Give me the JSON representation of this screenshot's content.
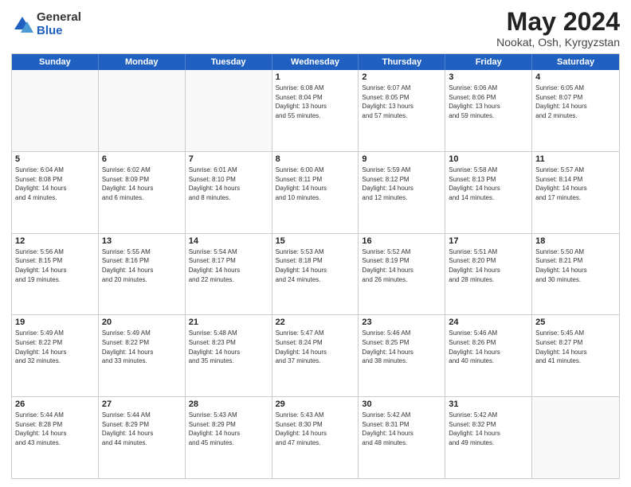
{
  "logo": {
    "general": "General",
    "blue": "Blue"
  },
  "title": {
    "month": "May 2024",
    "location": "Nookat, Osh, Kyrgyzstan"
  },
  "header_days": [
    "Sunday",
    "Monday",
    "Tuesday",
    "Wednesday",
    "Thursday",
    "Friday",
    "Saturday"
  ],
  "rows": [
    [
      {
        "day": "",
        "info": ""
      },
      {
        "day": "",
        "info": ""
      },
      {
        "day": "",
        "info": ""
      },
      {
        "day": "1",
        "info": "Sunrise: 6:08 AM\nSunset: 8:04 PM\nDaylight: 13 hours\nand 55 minutes."
      },
      {
        "day": "2",
        "info": "Sunrise: 6:07 AM\nSunset: 8:05 PM\nDaylight: 13 hours\nand 57 minutes."
      },
      {
        "day": "3",
        "info": "Sunrise: 6:06 AM\nSunset: 8:06 PM\nDaylight: 13 hours\nand 59 minutes."
      },
      {
        "day": "4",
        "info": "Sunrise: 6:05 AM\nSunset: 8:07 PM\nDaylight: 14 hours\nand 2 minutes."
      }
    ],
    [
      {
        "day": "5",
        "info": "Sunrise: 6:04 AM\nSunset: 8:08 PM\nDaylight: 14 hours\nand 4 minutes."
      },
      {
        "day": "6",
        "info": "Sunrise: 6:02 AM\nSunset: 8:09 PM\nDaylight: 14 hours\nand 6 minutes."
      },
      {
        "day": "7",
        "info": "Sunrise: 6:01 AM\nSunset: 8:10 PM\nDaylight: 14 hours\nand 8 minutes."
      },
      {
        "day": "8",
        "info": "Sunrise: 6:00 AM\nSunset: 8:11 PM\nDaylight: 14 hours\nand 10 minutes."
      },
      {
        "day": "9",
        "info": "Sunrise: 5:59 AM\nSunset: 8:12 PM\nDaylight: 14 hours\nand 12 minutes."
      },
      {
        "day": "10",
        "info": "Sunrise: 5:58 AM\nSunset: 8:13 PM\nDaylight: 14 hours\nand 14 minutes."
      },
      {
        "day": "11",
        "info": "Sunrise: 5:57 AM\nSunset: 8:14 PM\nDaylight: 14 hours\nand 17 minutes."
      }
    ],
    [
      {
        "day": "12",
        "info": "Sunrise: 5:56 AM\nSunset: 8:15 PM\nDaylight: 14 hours\nand 19 minutes."
      },
      {
        "day": "13",
        "info": "Sunrise: 5:55 AM\nSunset: 8:16 PM\nDaylight: 14 hours\nand 20 minutes."
      },
      {
        "day": "14",
        "info": "Sunrise: 5:54 AM\nSunset: 8:17 PM\nDaylight: 14 hours\nand 22 minutes."
      },
      {
        "day": "15",
        "info": "Sunrise: 5:53 AM\nSunset: 8:18 PM\nDaylight: 14 hours\nand 24 minutes."
      },
      {
        "day": "16",
        "info": "Sunrise: 5:52 AM\nSunset: 8:19 PM\nDaylight: 14 hours\nand 26 minutes."
      },
      {
        "day": "17",
        "info": "Sunrise: 5:51 AM\nSunset: 8:20 PM\nDaylight: 14 hours\nand 28 minutes."
      },
      {
        "day": "18",
        "info": "Sunrise: 5:50 AM\nSunset: 8:21 PM\nDaylight: 14 hours\nand 30 minutes."
      }
    ],
    [
      {
        "day": "19",
        "info": "Sunrise: 5:49 AM\nSunset: 8:22 PM\nDaylight: 14 hours\nand 32 minutes."
      },
      {
        "day": "20",
        "info": "Sunrise: 5:49 AM\nSunset: 8:22 PM\nDaylight: 14 hours\nand 33 minutes."
      },
      {
        "day": "21",
        "info": "Sunrise: 5:48 AM\nSunset: 8:23 PM\nDaylight: 14 hours\nand 35 minutes."
      },
      {
        "day": "22",
        "info": "Sunrise: 5:47 AM\nSunset: 8:24 PM\nDaylight: 14 hours\nand 37 minutes."
      },
      {
        "day": "23",
        "info": "Sunrise: 5:46 AM\nSunset: 8:25 PM\nDaylight: 14 hours\nand 38 minutes."
      },
      {
        "day": "24",
        "info": "Sunrise: 5:46 AM\nSunset: 8:26 PM\nDaylight: 14 hours\nand 40 minutes."
      },
      {
        "day": "25",
        "info": "Sunrise: 5:45 AM\nSunset: 8:27 PM\nDaylight: 14 hours\nand 41 minutes."
      }
    ],
    [
      {
        "day": "26",
        "info": "Sunrise: 5:44 AM\nSunset: 8:28 PM\nDaylight: 14 hours\nand 43 minutes."
      },
      {
        "day": "27",
        "info": "Sunrise: 5:44 AM\nSunset: 8:29 PM\nDaylight: 14 hours\nand 44 minutes."
      },
      {
        "day": "28",
        "info": "Sunrise: 5:43 AM\nSunset: 8:29 PM\nDaylight: 14 hours\nand 45 minutes."
      },
      {
        "day": "29",
        "info": "Sunrise: 5:43 AM\nSunset: 8:30 PM\nDaylight: 14 hours\nand 47 minutes."
      },
      {
        "day": "30",
        "info": "Sunrise: 5:42 AM\nSunset: 8:31 PM\nDaylight: 14 hours\nand 48 minutes."
      },
      {
        "day": "31",
        "info": "Sunrise: 5:42 AM\nSunset: 8:32 PM\nDaylight: 14 hours\nand 49 minutes."
      },
      {
        "day": "",
        "info": ""
      }
    ]
  ]
}
